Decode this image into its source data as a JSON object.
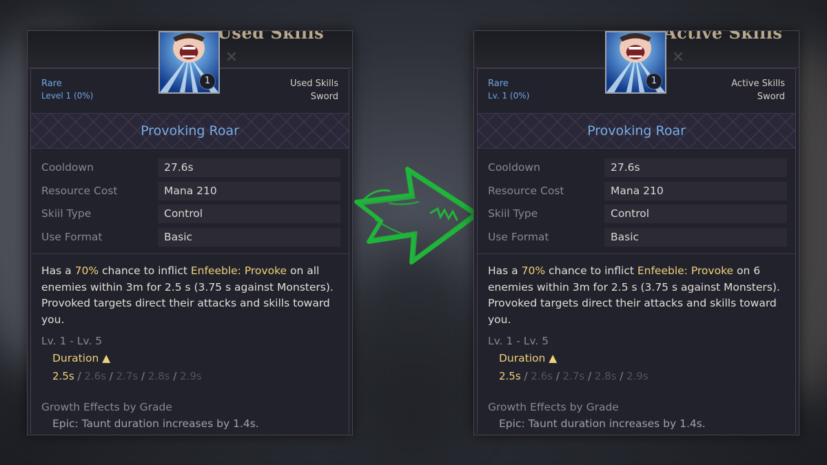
{
  "colors": {
    "rarity_blue": "#6ea6e8",
    "highlight_gold": "#f0d27a",
    "arrow_green": "#21b43a",
    "panel_bg": "#22222c"
  },
  "arrow": {
    "icon": "green-hand-drawn-arrow-icon",
    "direction": "right"
  },
  "left_card": {
    "header_title": "Used Skills",
    "icon_name": "provoking-roar-skill-icon",
    "icon_level": "1",
    "rarity": "Rare",
    "level": "Level 1 (0%)",
    "category": "Used Skills",
    "weapon": "Sword",
    "name": "Provoking Roar",
    "stats": [
      {
        "label": "Cooldown",
        "value": "27.6s"
      },
      {
        "label": "Resource Cost",
        "value": "Mana 210"
      },
      {
        "label": "Skiil Type",
        "value": "Control"
      },
      {
        "label": "Use Format",
        "value": "Basic"
      }
    ],
    "desc": {
      "p1": "Has a ",
      "chance": "70%",
      "p2": " chance to inflict ",
      "effect": "Enfeeble: Provoke",
      "p3": " on all enemies within 3m for 2.5 s (3.75 s against Monsters). Provoked targets direct their attacks and skills toward you."
    },
    "level_range": "Lv. 1 - Lv. 5",
    "duration_label": "Duration ▲",
    "durations": [
      "2.5s",
      "2.6s",
      "2.7s",
      "2.8s",
      "2.9s"
    ],
    "growth_title": "Growth Effects by Grade",
    "growth_item": "Epic: Taunt duration increases by 1.4s."
  },
  "right_card": {
    "header_title": "Active Skills",
    "icon_name": "provoking-roar-skill-icon",
    "icon_level": "1",
    "rarity": "Rare",
    "level": "Lv. 1 (0%)",
    "category": "Active Skills",
    "weapon": "Sword",
    "name": "Provoking Roar",
    "stats": [
      {
        "label": "Cooldown",
        "value": "27.6s"
      },
      {
        "label": "Resource Cost",
        "value": "Mana 210"
      },
      {
        "label": "Skiil Type",
        "value": "Control"
      },
      {
        "label": "Use Format",
        "value": "Basic"
      }
    ],
    "desc": {
      "p1": "Has a ",
      "chance": "70%",
      "p2": " chance to inflict ",
      "effect": "Enfeeble: Provoke",
      "p3": " on 6 enemies within 3m for 2.5 s (3.75 s against Monsters). Provoked targets direct their attacks and skills toward you."
    },
    "level_range": "Lv. 1 - Lv. 5",
    "duration_label": "Duration ▲",
    "durations": [
      "2.5s",
      "2.6s",
      "2.7s",
      "2.8s",
      "2.9s"
    ],
    "growth_title": "Growth Effects by Grade",
    "growth_item": "Epic: Taunt duration increases by 1.4s."
  }
}
